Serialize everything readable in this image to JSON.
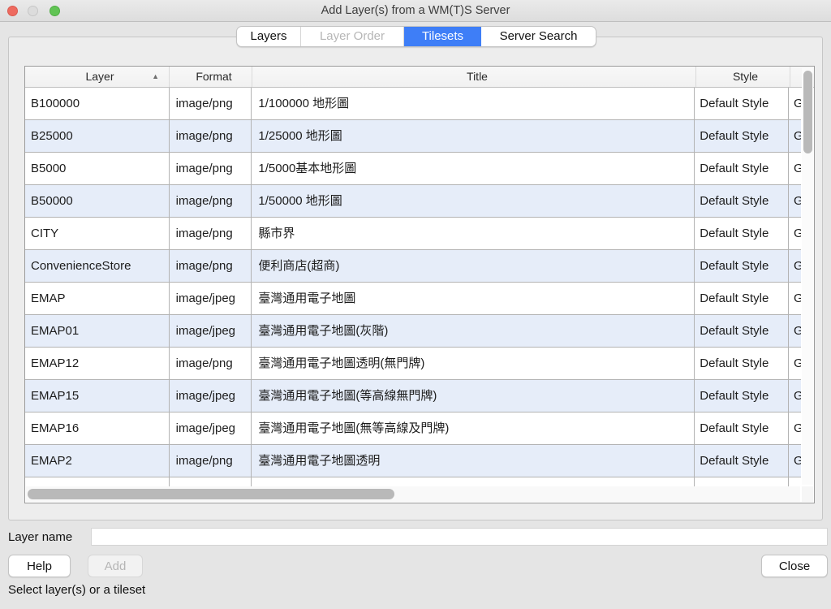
{
  "window": {
    "title": "Add Layer(s) from a WM(T)S Server"
  },
  "tabs": [
    {
      "label": "Layers",
      "state": "normal"
    },
    {
      "label": "Layer Order",
      "state": "disabled"
    },
    {
      "label": "Tilesets",
      "state": "selected"
    },
    {
      "label": "Server Search",
      "state": "normal"
    }
  ],
  "table": {
    "headers": {
      "layer": "Layer",
      "format": "Format",
      "title": "Title",
      "style": "Style",
      "clipped": ""
    },
    "sort_indicator": {
      "column": "Layer",
      "direction": "ascending",
      "icon": "▲"
    },
    "rows": [
      {
        "layer": "B100000",
        "format": "image/png",
        "title": "1/100000 地形圖",
        "style": "Default Style",
        "clipped": "G"
      },
      {
        "layer": "B25000",
        "format": "image/png",
        "title": "1/25000 地形圖",
        "style": "Default Style",
        "clipped": "G"
      },
      {
        "layer": "B5000",
        "format": "image/png",
        "title": "1/5000基本地形圖",
        "style": "Default Style",
        "clipped": "G"
      },
      {
        "layer": "B50000",
        "format": "image/png",
        "title": "1/50000 地形圖",
        "style": "Default Style",
        "clipped": "G"
      },
      {
        "layer": "CITY",
        "format": "image/png",
        "title": "縣市界",
        "style": "Default Style",
        "clipped": "G"
      },
      {
        "layer": "ConvenienceStore",
        "format": "image/png",
        "title": "便利商店(超商)",
        "style": "Default Style",
        "clipped": "G"
      },
      {
        "layer": "EMAP",
        "format": "image/jpeg",
        "title": "臺灣通用電子地圖",
        "style": "Default Style",
        "clipped": "G"
      },
      {
        "layer": "EMAP01",
        "format": "image/jpeg",
        "title": "臺灣通用電子地圖(灰階)",
        "style": "Default Style",
        "clipped": "G"
      },
      {
        "layer": "EMAP12",
        "format": "image/png",
        "title": "臺灣通用電子地圖透明(無門牌)",
        "style": "Default Style",
        "clipped": "G"
      },
      {
        "layer": "EMAP15",
        "format": "image/jpeg",
        "title": "臺灣通用電子地圖(等高線無門牌)",
        "style": "Default Style",
        "clipped": "G"
      },
      {
        "layer": "EMAP16",
        "format": "image/jpeg",
        "title": "臺灣通用電子地圖(無等高線及門牌)",
        "style": "Default Style",
        "clipped": "G"
      },
      {
        "layer": "EMAP2",
        "format": "image/png",
        "title": "臺灣通用電子地圖透明",
        "style": "Default Style",
        "clipped": "G"
      }
    ]
  },
  "layer_name": {
    "label": "Layer name",
    "value": ""
  },
  "buttons": {
    "help": "Help",
    "add": "Add",
    "close": "Close"
  },
  "status": "Select layer(s) or a tileset",
  "colors": {
    "selected_tab_bg": "#3e7ef7",
    "alt_row_bg": "#e6edf9",
    "window_bg": "#e5e5e5",
    "close_red": "#ee6a5f",
    "minimize_gray": "#dcdcdc",
    "zoom_green": "#61c454"
  }
}
